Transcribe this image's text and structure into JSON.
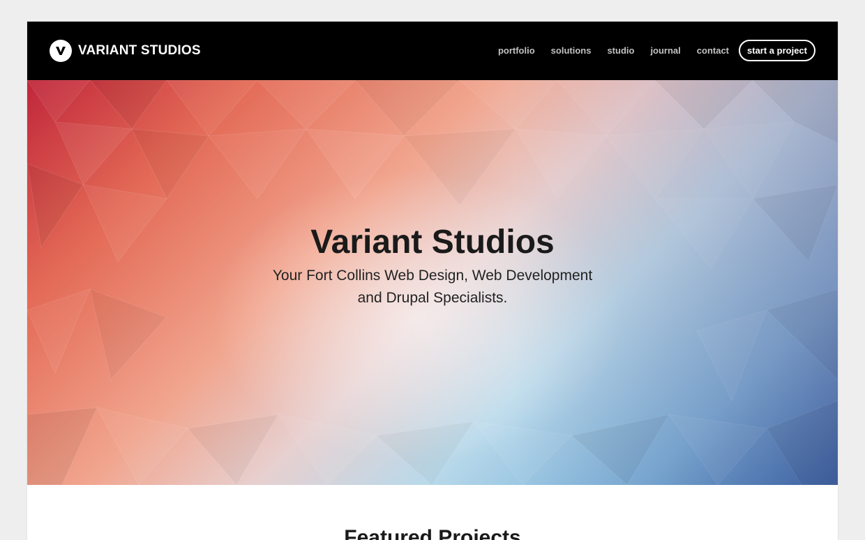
{
  "header": {
    "brand": "VARIANT STUDIOS",
    "logo_icon": "v-logo-icon",
    "nav": [
      {
        "label": "portfolio"
      },
      {
        "label": "solutions"
      },
      {
        "label": "studio"
      },
      {
        "label": "journal"
      },
      {
        "label": "contact"
      }
    ],
    "cta_label": "start a project"
  },
  "hero": {
    "title": "Variant Studios",
    "subtitle_line1": "Your Fort Collins Web Design, Web Development",
    "subtitle_line2": "and Drupal Specialists."
  },
  "featured": {
    "heading": "Featured Projects"
  },
  "colors": {
    "header_bg": "#000000",
    "nav_text": "#c2c2c2",
    "page_bg": "#eeeeee",
    "hero_warm": "#e36a56",
    "hero_cool": "#2a6cb1"
  }
}
